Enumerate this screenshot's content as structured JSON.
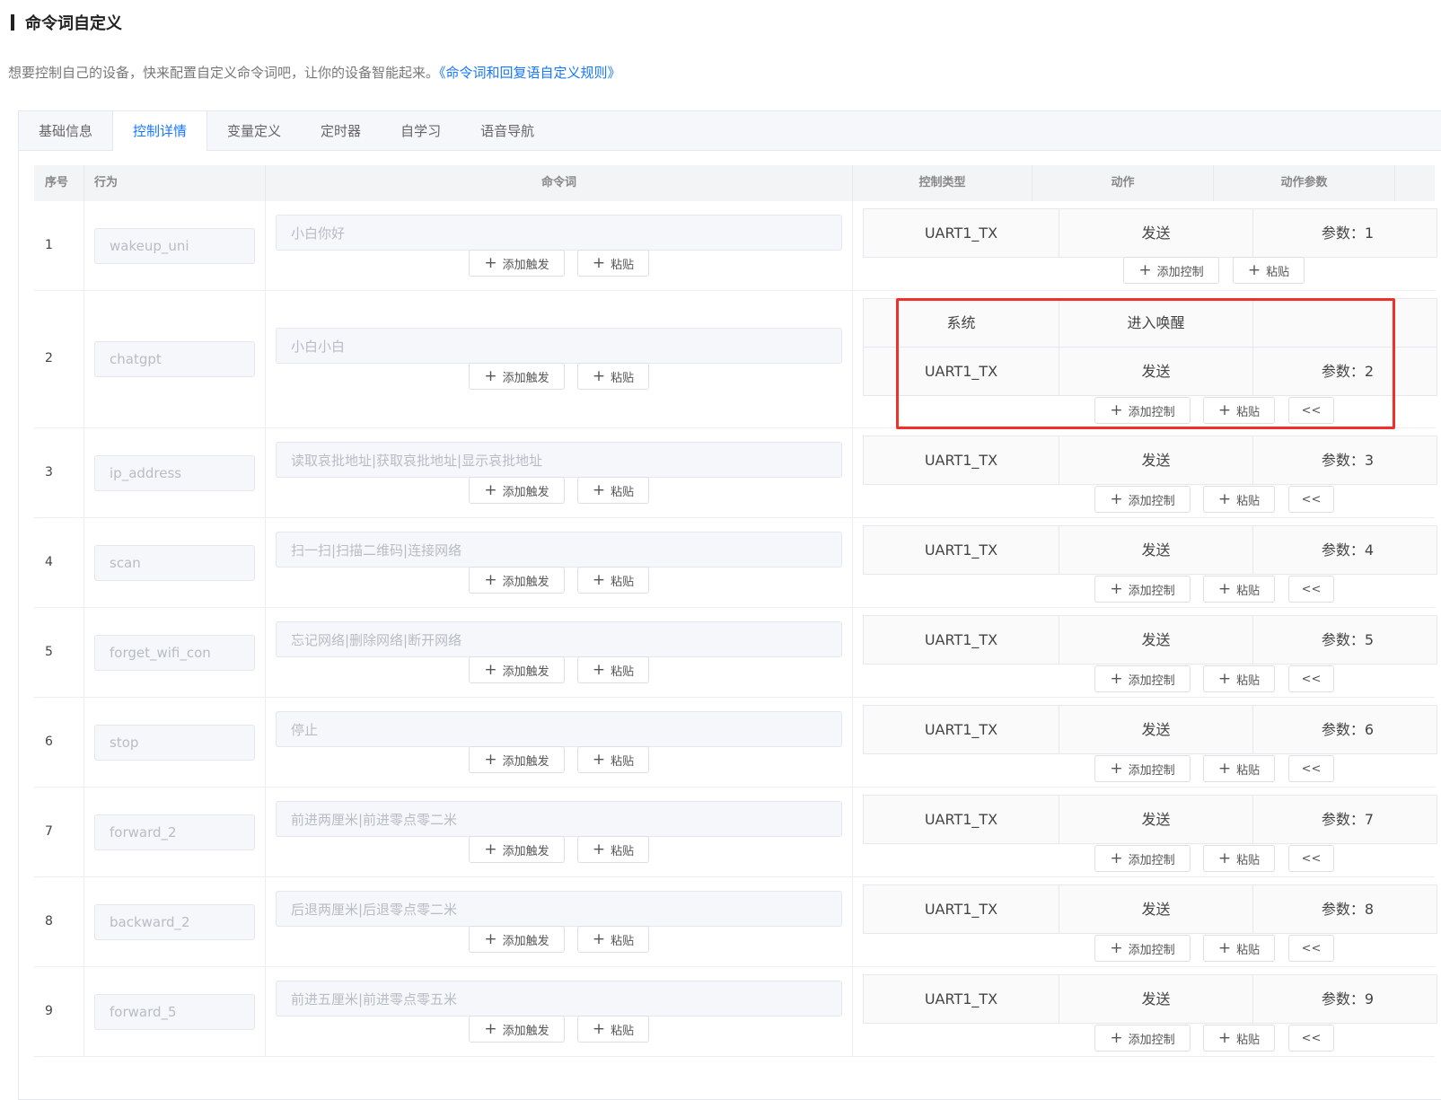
{
  "page": {
    "title": "命令词自定义",
    "description": "想要控制自己的设备，快来配置自定义命令词吧，让你的设备智能起来。",
    "rules_link": "《命令词和回复语自定义规则》"
  },
  "tabs": [
    "基础信息",
    "控制详情",
    "变量定义",
    "定时器",
    "自学习",
    "语音导航"
  ],
  "active_tab": "控制详情",
  "table": {
    "headers": {
      "no": "序号",
      "behavior": "行为",
      "command": "命令词",
      "control_type": "控制类型",
      "action": "动作",
      "action_params": "动作参数"
    },
    "buttons": {
      "add_trigger": "添加触发",
      "paste": "粘贴",
      "add_control": "添加控制",
      "collapse": "<<"
    },
    "rows": [
      {
        "no": "1",
        "behavior": "wakeup_uni",
        "commands": "小白你好",
        "controls": [
          {
            "type": "UART1_TX",
            "action": "发送",
            "param": "参数：1"
          }
        ]
      },
      {
        "no": "2",
        "behavior": "chatgpt",
        "commands": "小白小白",
        "controls": [
          {
            "type": "系统",
            "action": "进入唤醒",
            "param": ""
          },
          {
            "type": "UART1_TX",
            "action": "发送",
            "param": "参数：2"
          }
        ]
      },
      {
        "no": "3",
        "behavior": "ip_address",
        "commands": "读取哀批地址|获取哀批地址|显示哀批地址",
        "controls": [
          {
            "type": "UART1_TX",
            "action": "发送",
            "param": "参数：3"
          }
        ]
      },
      {
        "no": "4",
        "behavior": "scan",
        "commands": "扫一扫|扫描二维码|连接网络",
        "controls": [
          {
            "type": "UART1_TX",
            "action": "发送",
            "param": "参数：4"
          }
        ]
      },
      {
        "no": "5",
        "behavior": "forget_wifi_con",
        "commands": "忘记网络|删除网络|断开网络",
        "controls": [
          {
            "type": "UART1_TX",
            "action": "发送",
            "param": "参数：5"
          }
        ]
      },
      {
        "no": "6",
        "behavior": "stop",
        "commands": "停止",
        "controls": [
          {
            "type": "UART1_TX",
            "action": "发送",
            "param": "参数：6"
          }
        ]
      },
      {
        "no": "7",
        "behavior": "forward_2",
        "commands": "前进两厘米|前进零点零二米",
        "controls": [
          {
            "type": "UART1_TX",
            "action": "发送",
            "param": "参数：7"
          }
        ]
      },
      {
        "no": "8",
        "behavior": "backward_2",
        "commands": "后退两厘米|后退零点零二米",
        "controls": [
          {
            "type": "UART1_TX",
            "action": "发送",
            "param": "参数：8"
          }
        ]
      },
      {
        "no": "9",
        "behavior": "forward_5",
        "commands": "前进五厘米|前进零点零五米",
        "controls": [
          {
            "type": "UART1_TX",
            "action": "发送",
            "param": "参数：9"
          }
        ]
      }
    ]
  },
  "highlight_color": "#f0302a",
  "accent_color": "#1677ff"
}
